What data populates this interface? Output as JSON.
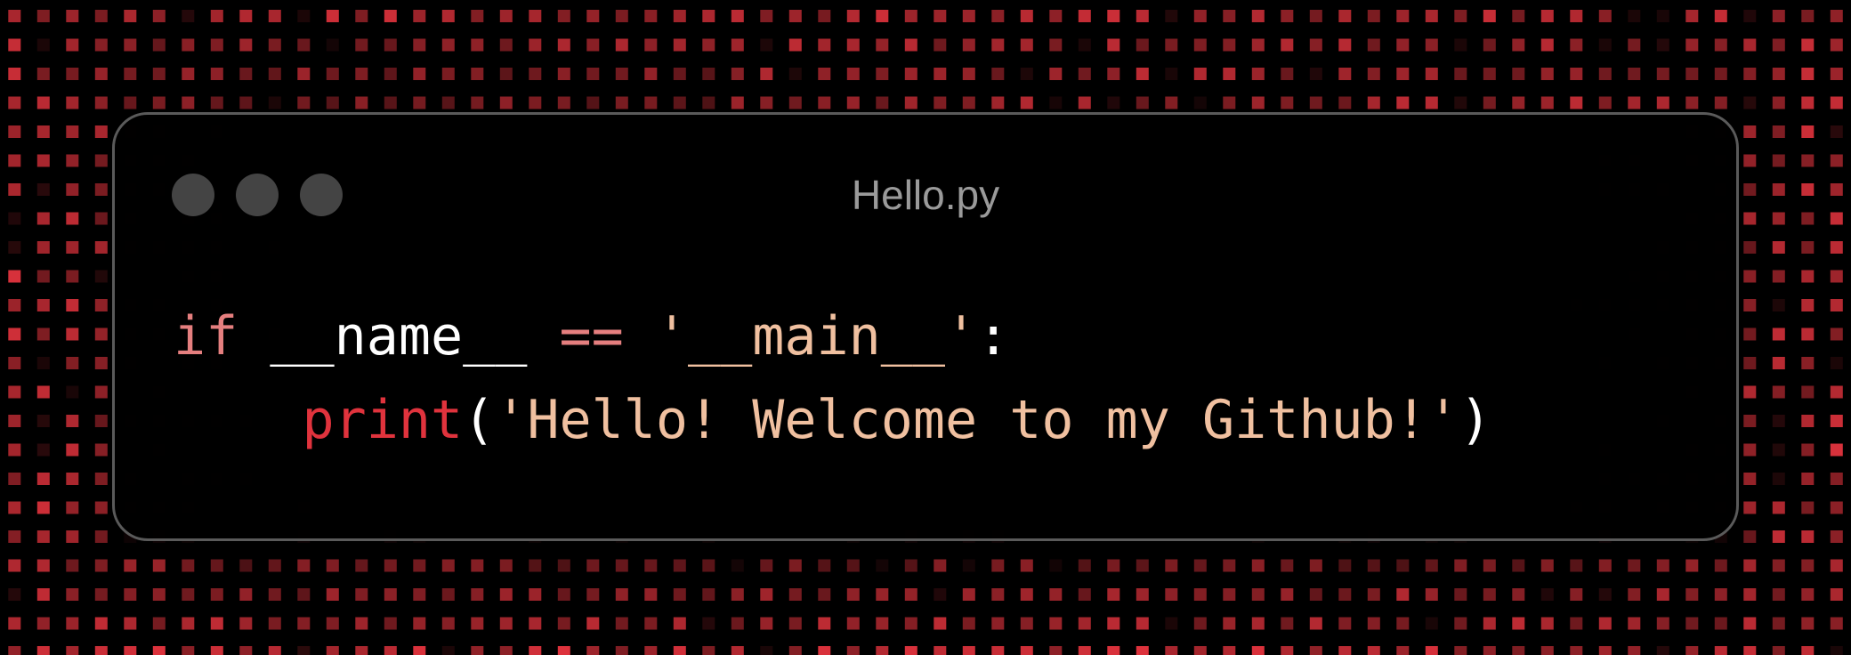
{
  "window": {
    "title": "Hello.py",
    "traffic_lights": [
      "close",
      "minimize",
      "maximize"
    ]
  },
  "code": {
    "line1": {
      "keyword": "if",
      "space1": " ",
      "ident": "__name__",
      "space2": " ",
      "op": "==",
      "space3": " ",
      "string": "'__main__'",
      "colon": ":"
    },
    "line2": {
      "indent": "    ",
      "fn": "print",
      "open": "(",
      "string": "'Hello! Welcome to my Github!'",
      "close": ")"
    }
  },
  "colors": {
    "background": "#000000",
    "accent_red": "#e0333d",
    "keyword": "#e57f7f",
    "string": "#f0c0a0",
    "window_border": "#5a5a5a",
    "title_text": "#9a9a9a"
  }
}
